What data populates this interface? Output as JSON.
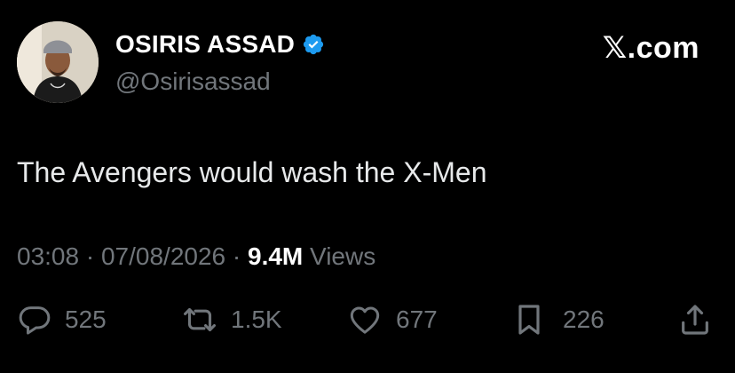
{
  "author": {
    "display_name": "OSIRIS ASSAD",
    "handle": "@Osirisassad",
    "verified": true
  },
  "brand": "𝕏.com",
  "tweet": {
    "text": "The Avengers would wash the X-Men"
  },
  "meta": {
    "time": "03:08",
    "separator": "·",
    "date": "07/08/2026",
    "views_count": "9.4M",
    "views_label": "Views"
  },
  "actions": {
    "replies": "525",
    "reposts": "1.5K",
    "likes": "677",
    "bookmarks": "226"
  },
  "colors": {
    "background": "#000000",
    "primary_text": "#e7e9ea",
    "secondary_text": "#71767b",
    "verified_badge": "#1d9bf0"
  }
}
